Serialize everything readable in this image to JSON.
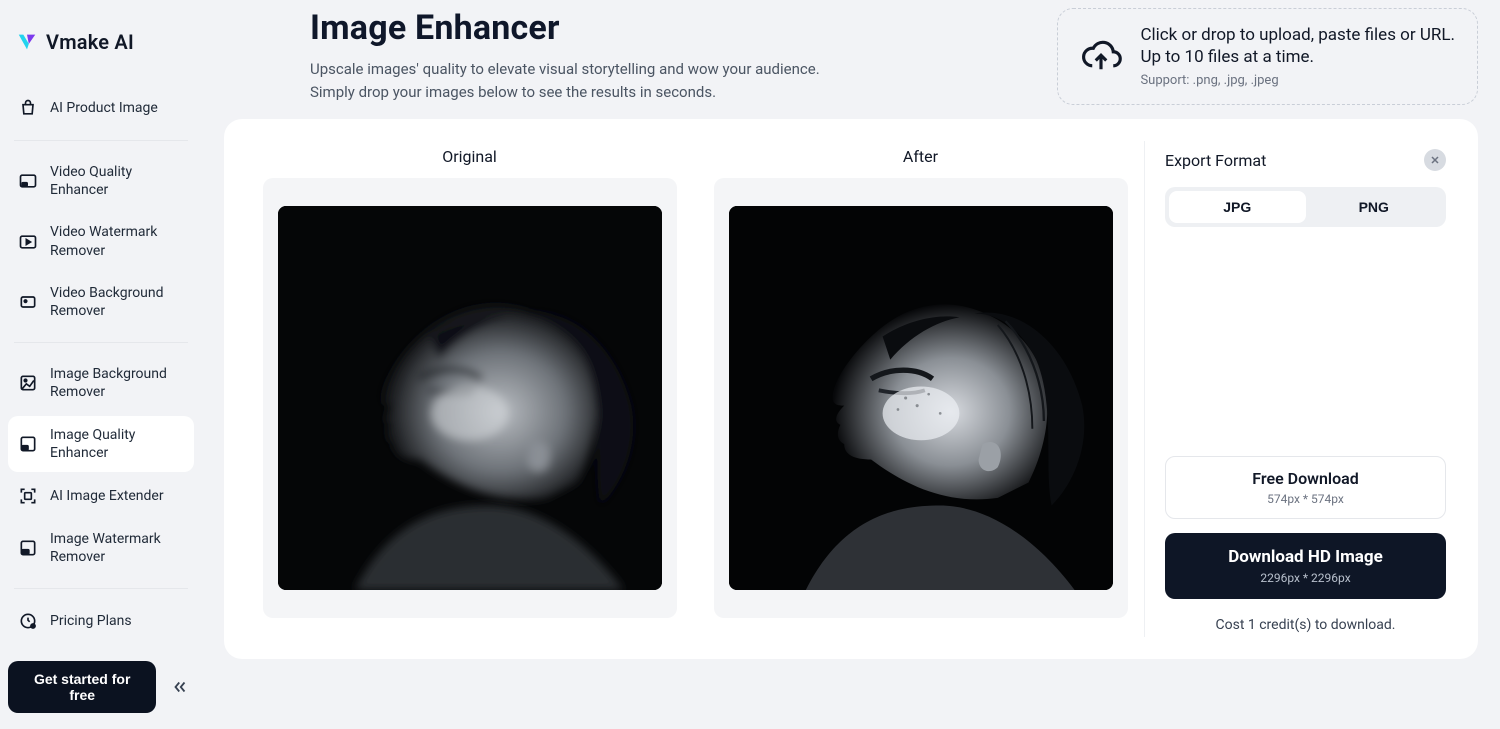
{
  "brand": {
    "name": "Vmake AI"
  },
  "sidebar": {
    "items": [
      {
        "label": "AI Product Image"
      },
      {
        "label": "Video Quality Enhancer"
      },
      {
        "label": "Video Watermark Remover"
      },
      {
        "label": "Video Background Remover"
      },
      {
        "label": "Image Background Remover"
      },
      {
        "label": "Image Quality Enhancer"
      },
      {
        "label": "AI Image Extender"
      },
      {
        "label": "Image Watermark Remover"
      },
      {
        "label": "Pricing Plans"
      }
    ],
    "cta": "Get started for free"
  },
  "header": {
    "title": "Image Enhancer",
    "subtitle_line1": "Upscale images' quality to elevate visual storytelling and wow your audience.",
    "subtitle_line2": "Simply drop your images below to see the results in seconds."
  },
  "dropzone": {
    "line1": "Click or drop to upload, paste files or URL.",
    "line2": "Up to 10 files at a time.",
    "line3": "Support: .png, .jpg, .jpeg"
  },
  "compare": {
    "left_title": "Original",
    "right_title": "After"
  },
  "export": {
    "title": "Export Format",
    "formats": [
      {
        "label": "JPG",
        "active": true
      },
      {
        "label": "PNG",
        "active": false
      }
    ],
    "free": {
      "label": "Free Download",
      "sub": "574px * 574px"
    },
    "hd": {
      "label": "Download HD Image",
      "sub": "2296px * 2296px"
    },
    "cost": "Cost 1 credit(s) to download."
  }
}
